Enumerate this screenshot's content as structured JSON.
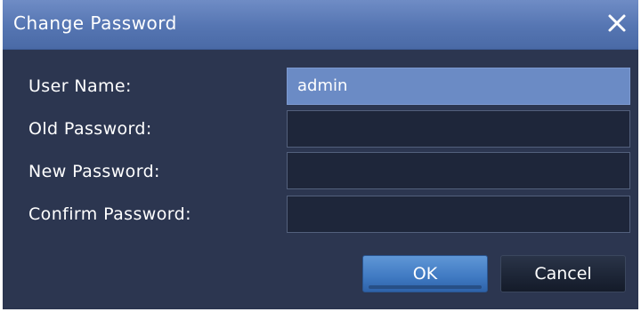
{
  "dialog": {
    "title": "Change Password",
    "close_icon": "close-icon"
  },
  "form": {
    "username_label": "User Name:",
    "username_value": "admin",
    "old_password_label": "Old Password:",
    "old_password_value": "",
    "new_password_label": "New Password:",
    "new_password_value": "",
    "confirm_password_label": "Confirm Password:",
    "confirm_password_value": ""
  },
  "buttons": {
    "ok_label": "OK",
    "cancel_label": "Cancel"
  },
  "colors": {
    "titlebar": "#5575b2",
    "body": "#2c3650",
    "field": "#1e263a",
    "field_active": "#6b8bc5",
    "ok_button": "#3f79c2",
    "cancel_button": "#1c2435"
  }
}
